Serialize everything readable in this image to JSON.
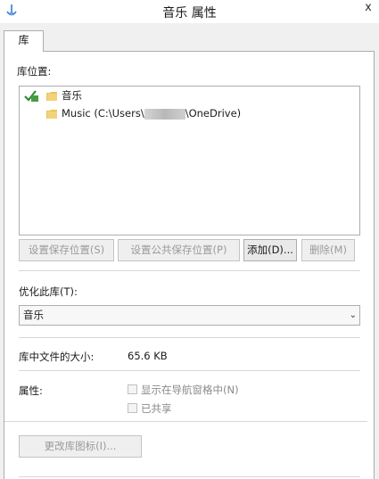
{
  "window": {
    "title": "音乐 属性",
    "close_label": "x"
  },
  "tab": {
    "label": "库"
  },
  "locations": {
    "heading": "库位置:",
    "items": [
      {
        "label": "音乐"
      },
      {
        "label_prefix": "Music (C:\\Users\\",
        "label_suffix": "\\OneDrive)"
      }
    ]
  },
  "buttons": {
    "set_save": "设置保存位置(S)",
    "set_public_save": "设置公共保存位置(P)",
    "add": "添加(D)...",
    "remove": "删除(M)"
  },
  "optimize": {
    "label": "优化此库(T):",
    "selected": "音乐"
  },
  "size": {
    "label": "库中文件的大小:",
    "value": "65.6 KB"
  },
  "attributes": {
    "label": "属性:",
    "show_in_nav": "显示在导航窗格中(N)",
    "shared": "已共享"
  },
  "change_icon_button": "更改库图标(I)..."
}
